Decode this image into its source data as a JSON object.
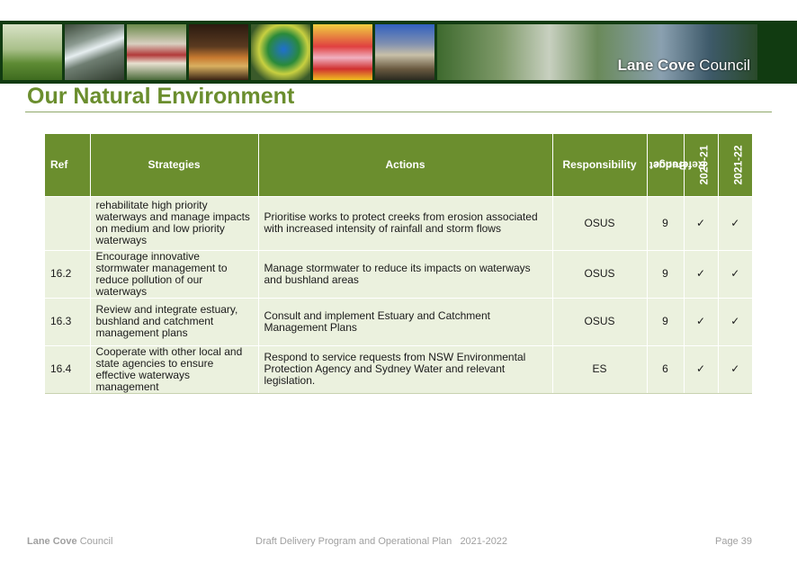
{
  "banner": {
    "logo_bold": "Lane Cove",
    "logo_regular": " Council"
  },
  "page_title": "Our Natural Environment",
  "table": {
    "headers": {
      "ref": "Ref",
      "strategies": "Strategies",
      "actions": "Actions",
      "responsibility": "Responsibility",
      "budget_line1": "Budget",
      "budget_line2": "Reference",
      "year1": "2020-21",
      "year2": "2021-22"
    },
    "rows": [
      {
        "ref": "",
        "strategy": "rehabilitate high priority waterways and manage impacts on medium and low priority waterways",
        "action": "Prioritise works to protect creeks from erosion associated with increased intensity of rainfall and storm flows",
        "responsibility": "OSUS",
        "budget": "9",
        "y1": "✓",
        "y2": "✓"
      },
      {
        "ref": "16.2",
        "strategy": "Encourage innovative stormwater management to reduce pollution of our waterways",
        "action": "Manage stormwater to reduce its impacts on waterways and bushland areas",
        "responsibility": "OSUS",
        "budget": "9",
        "y1": "✓",
        "y2": "✓"
      },
      {
        "ref": "16.3",
        "strategy": "Review and integrate estuary, bushland and catchment management plans",
        "action": "Consult and implement Estuary and Catchment Management Plans",
        "responsibility": "OSUS",
        "budget": "9",
        "y1": "✓",
        "y2": "✓"
      },
      {
        "ref": "16.4",
        "strategy": "Cooperate with other local and state agencies to ensure effective waterways management",
        "action": "Respond to service requests from NSW Environmental Protection Agency and Sydney Water and relevant legislation.",
        "responsibility": "ES",
        "budget": "6",
        "y1": "✓",
        "y2": "✓"
      }
    ]
  },
  "footer": {
    "council_bold": "Lane Cove",
    "council_regular": " Council",
    "doc_title": "Draft Delivery Program and Operational Plan",
    "doc_years": "2021-2022",
    "page": "Page 39"
  }
}
